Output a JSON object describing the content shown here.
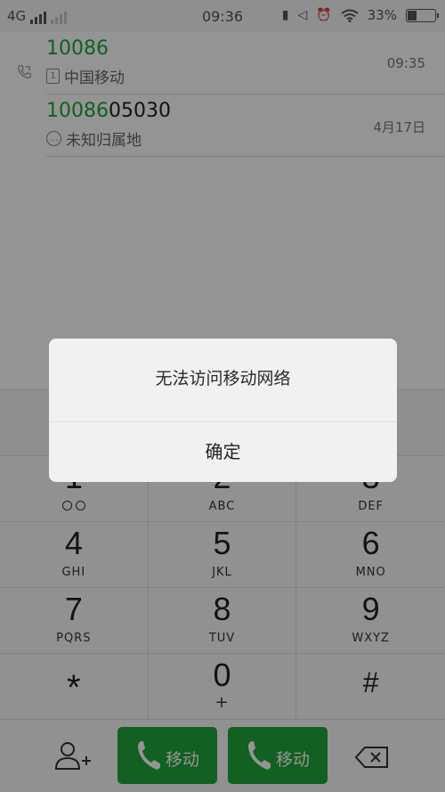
{
  "status_bar": {
    "network": "4G",
    "time": "09:36",
    "battery_text": "33%",
    "battery_level": 0.33
  },
  "recents": [
    {
      "number_match": "10086",
      "number_rest": "",
      "location": "中国移动",
      "time": "09:35"
    },
    {
      "number_match": "10086",
      "number_rest": "05030",
      "location": "未知归属地",
      "time": "4月17日"
    }
  ],
  "keypad": [
    {
      "digit": "1",
      "letters": ""
    },
    {
      "digit": "2",
      "letters": "ABC"
    },
    {
      "digit": "3",
      "letters": "DEF"
    },
    {
      "digit": "4",
      "letters": "GHI"
    },
    {
      "digit": "5",
      "letters": "JKL"
    },
    {
      "digit": "6",
      "letters": "MNO"
    },
    {
      "digit": "7",
      "letters": "PQRS"
    },
    {
      "digit": "8",
      "letters": "TUV"
    },
    {
      "digit": "9",
      "letters": "WXYZ"
    },
    {
      "digit": "*",
      "letters": ""
    },
    {
      "digit": "0",
      "letters": "+"
    },
    {
      "digit": "#",
      "letters": ""
    }
  ],
  "actions": {
    "call1_label": "移动",
    "call2_label": "移动"
  },
  "dialog": {
    "message": "无法访问移动网络",
    "ok_label": "确定"
  },
  "colors": {
    "accent_green": "#1fa53b",
    "dialog_bg": "#f1f1f1"
  }
}
